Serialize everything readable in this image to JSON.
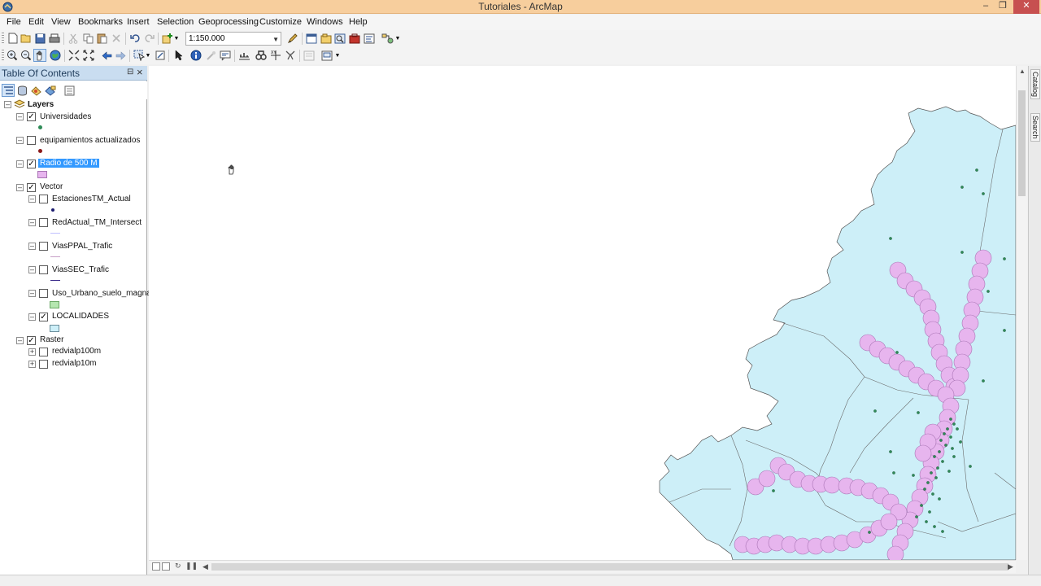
{
  "window": {
    "title": "Tutoriales - ArcMap",
    "controls": [
      "minimize",
      "maximize",
      "close"
    ]
  },
  "menu": {
    "items": [
      "File",
      "Edit",
      "View",
      "Bookmarks",
      "Insert",
      "Selection",
      "Geoprocessing",
      "Customize",
      "Windows",
      "Help"
    ]
  },
  "standard_toolbar": {
    "scale": "1:150.000",
    "icons": [
      "new-document-icon",
      "open-icon",
      "save-icon",
      "print-icon",
      "cut-icon",
      "copy-icon",
      "paste-icon",
      "delete-icon",
      "undo-icon",
      "redo-icon",
      "add-data-icon",
      "editor-icon",
      "toc-window-icon",
      "catalog-icon",
      "search-icon",
      "arctoolbox-icon",
      "python-icon",
      "model-builder-icon"
    ]
  },
  "tools_toolbar": {
    "icons": [
      "zoom-in-icon",
      "zoom-out-icon",
      "pan-icon",
      "full-extent-icon",
      "fixed-zoom-in-icon",
      "fixed-zoom-out-icon",
      "back-extent-icon",
      "forward-extent-icon",
      "select-features-icon",
      "clear-selection-icon",
      "select-elements-icon",
      "identify-icon",
      "html-popup-icon",
      "measure-icon",
      "find-icon",
      "find-route-icon",
      "go-to-xy-icon",
      "time-slider-icon",
      "create-viewer-icon"
    ]
  },
  "toc": {
    "title": "Table Of Contents",
    "tool_icons": [
      "list-by-drawing-order-icon",
      "list-by-source-icon",
      "list-by-visibility-icon",
      "list-by-selection-icon",
      "options-icon"
    ],
    "root": "Layers",
    "layers": {
      "universidades": {
        "label": "Universidades",
        "checked": true,
        "symbol_color": "#2e8b57"
      },
      "equipamientos": {
        "label": "equipamientos actualizados",
        "checked": false,
        "symbol_color": "#8b1a1a"
      },
      "radio": {
        "label": "Radio de 500 M",
        "checked": true,
        "selected": true,
        "symbol_color": "#e7b5ee"
      },
      "vector": {
        "label": "Vector",
        "checked": true
      },
      "estaciones": {
        "label": "EstacionesTM_Actual",
        "checked": false,
        "symbol_color": "#1a1a6e"
      },
      "redactual": {
        "label": "RedActual_TM_Intersect",
        "checked": false,
        "symbol_color": "#c0c0ff"
      },
      "viasppal": {
        "label": "ViasPPAL_Trafic",
        "checked": false,
        "symbol_color": "#c8a0c8"
      },
      "viassec": {
        "label": "ViasSEC_Trafic",
        "checked": false,
        "symbol_color": "#3a2a8a"
      },
      "uso": {
        "label": "Uso_Urbano_suelo_magna",
        "checked": false,
        "symbol_color": "#b5e6b0"
      },
      "localidades": {
        "label": "LOCALIDADES",
        "checked": true,
        "symbol_color": "#cdeff8"
      },
      "raster": {
        "label": "Raster",
        "checked": true
      },
      "redvial100": {
        "label": "redvialp100m",
        "checked": false
      },
      "redvial10": {
        "label": "redvialp10m",
        "checked": false
      }
    }
  },
  "side_tabs": [
    "Catalog",
    "Search"
  ],
  "map": {
    "land_color": "#cdeff8",
    "boundary_color": "#6a6a6a",
    "buffer_color": "#e7b5ee",
    "point_color": "#2e8b57"
  }
}
